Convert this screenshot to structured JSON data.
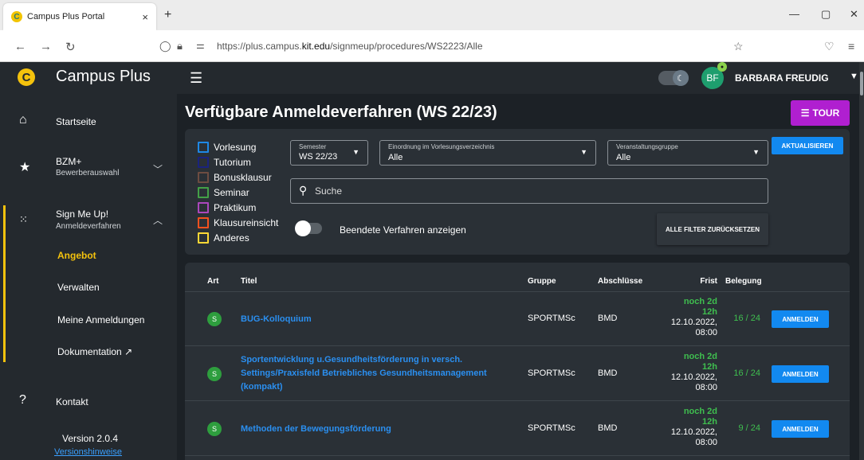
{
  "browser": {
    "tab_title": "Campus Plus Portal",
    "tab_close": "×",
    "new_tab": "+",
    "url_prefix": "https://plus.campus.",
    "url_domain": "kit.edu",
    "url_suffix": "/signmeup/procedures/WS2223/Alle",
    "window_controls": [
      "—",
      "▢",
      "✕"
    ]
  },
  "sidebar": {
    "brand": "Campus Plus",
    "items": [
      {
        "label": "Startseite",
        "icon": "home-icon"
      },
      {
        "label": "BZM+",
        "sub": "Bewerberauswahl",
        "icon": "star-icon"
      },
      {
        "label": "Sign Me Up!",
        "sub": "Anmeldeverfahren",
        "icon": "grid-icon"
      }
    ],
    "subitems": [
      "Angebot",
      "Verwalten",
      "Meine Anmeldungen",
      "Dokumentation"
    ],
    "kontakt": "Kontakt",
    "version": "Version 2.0.4",
    "version_link": "Versionshinweise"
  },
  "header": {
    "avatar": "BF",
    "user": "BARBARA FREUDIG"
  },
  "main": {
    "title": "Verfügbare Anmeldeverfahren (WS 22/23)",
    "tour": "TOUR",
    "types": [
      {
        "label": "Vorlesung",
        "color": "#1e88e5"
      },
      {
        "label": "Tutorium",
        "color": "#1a237e"
      },
      {
        "label": "Bonusklausur",
        "color": "#6d4c41"
      },
      {
        "label": "Seminar",
        "color": "#43a047"
      },
      {
        "label": "Praktikum",
        "color": "#ab47bc"
      },
      {
        "label": "Klausureinsicht",
        "color": "#f4511e"
      },
      {
        "label": "Anderes",
        "color": "#fdd835"
      }
    ],
    "semester": {
      "caption": "Semester",
      "value": "WS 22/23"
    },
    "einordnung": {
      "caption": "Einordnung im Vorlesungsverzeichnis",
      "value": "Alle"
    },
    "gruppe": {
      "caption": "Veranstaltungsgruppe",
      "value": "Alle"
    },
    "refresh": "AKTUALISIEREN",
    "search_placeholder": "Suche",
    "switch_label": "Beendete Verfahren anzeigen",
    "reset": "ALLE FILTER ZURÜCKSETZEN"
  },
  "table": {
    "headers": [
      "Art",
      "Titel",
      "Gruppe",
      "Abschlüsse",
      "Frist",
      "Belegung"
    ],
    "rows": [
      {
        "art": "S",
        "title": "BUG-Kolloquium",
        "gruppe": "SPORTMSc",
        "abschluss": "BMD",
        "rem1": "noch 2d",
        "rem2": "12h",
        "date1": "12.10.2022,",
        "date2": "08:00",
        "belegung": "16 / 24",
        "action": "ANMELDEN"
      },
      {
        "art": "S",
        "title": "Sportentwicklung u.Gesundheitsförderung in versch. Settings/Praxisfeld Betriebliches Gesundheitsmanagement (kompakt)",
        "gruppe": "SPORTMSc",
        "abschluss": "BMD",
        "rem1": "noch 2d",
        "rem2": "12h",
        "date1": "12.10.2022,",
        "date2": "08:00",
        "belegung": "16 / 24",
        "action": "ANMELDEN"
      },
      {
        "art": "S",
        "title": "Methoden der Bewegungsförderung",
        "gruppe": "SPORTMSc",
        "abschluss": "BMD",
        "rem1": "noch 2d",
        "rem2": "12h",
        "date1": "12.10.2022,",
        "date2": "08:00",
        "belegung": "9 / 24",
        "action": "ANMELDEN"
      }
    ]
  }
}
